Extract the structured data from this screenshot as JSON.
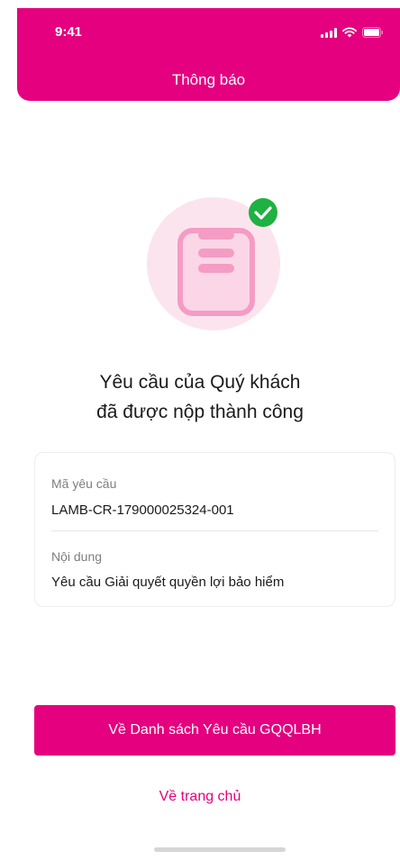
{
  "status_bar": {
    "time": "9:41"
  },
  "header": {
    "title": "Thông báo"
  },
  "message": {
    "line1": "Yêu cầu của Quý khách",
    "line2": "đã được nộp thành công"
  },
  "details": {
    "request_code_label": "Mã yêu cầu",
    "request_code_value": "LAMB-CR-179000025324-001",
    "content_label": "Nội dung",
    "content_value": "Yêu cầu Giải quyết quyền lợi bảo hiểm"
  },
  "actions": {
    "primary_label": "Về Danh sách Yêu cầu GQQLBH",
    "secondary_label": "Về trang chủ"
  },
  "colors": {
    "brand": "#E4007E",
    "success": "#1FB141",
    "illustration_bg": "#FCE4EF"
  },
  "icons": {
    "success": "check-circle-icon",
    "illustration": "phone-icon"
  }
}
